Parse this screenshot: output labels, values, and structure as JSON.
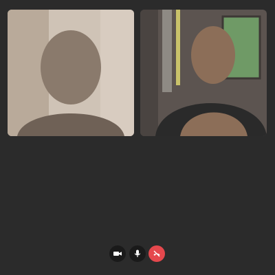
{
  "call": {
    "participants": [
      {
        "tile": "participant-left",
        "scene": "indoor-bedroom"
      },
      {
        "tile": "participant-right",
        "scene": "gym-with-window"
      }
    ]
  },
  "controls": {
    "camera_icon": "video-camera-icon",
    "mic_icon": "microphone-icon",
    "end_icon": "phone-hangup-icon"
  },
  "colors": {
    "background": "#2b2b2b",
    "control_dark": "#1a1a1a",
    "end_call": "#e5484d"
  }
}
